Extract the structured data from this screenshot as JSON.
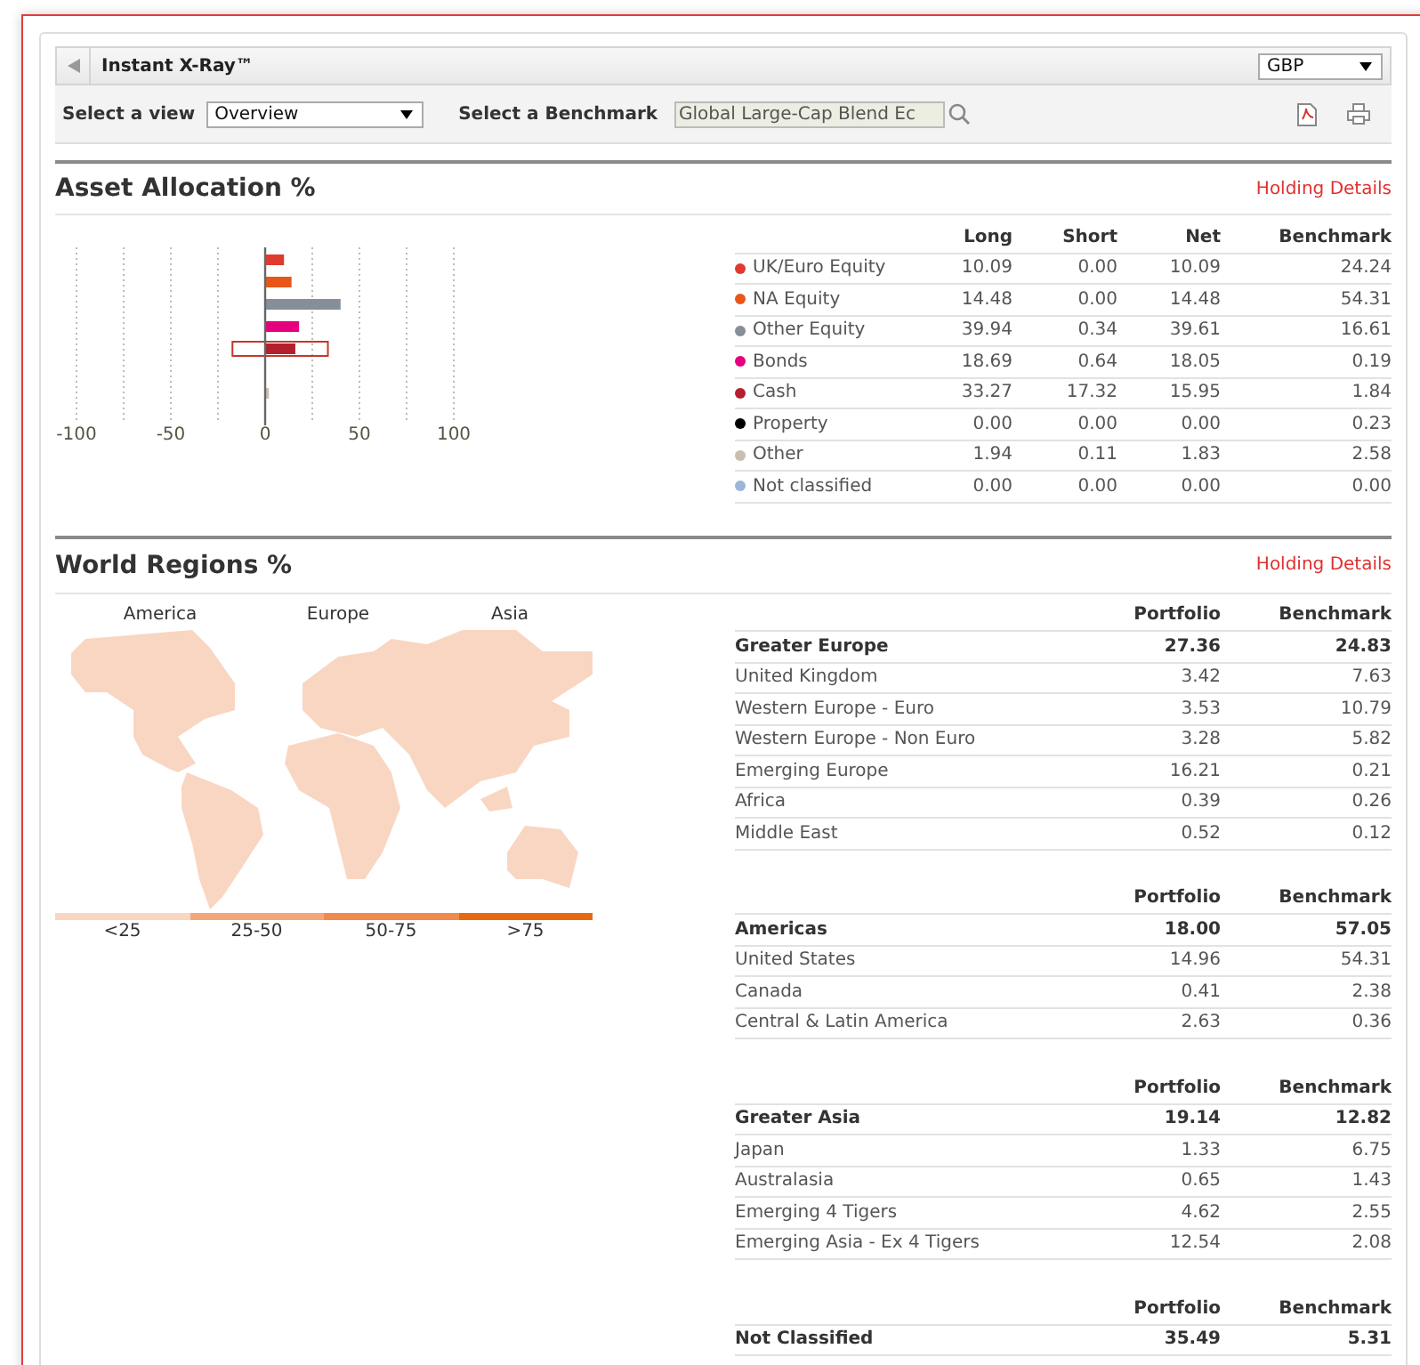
{
  "header": {
    "title": "Instant X-Ray™",
    "currency": "GBP"
  },
  "toolbar": {
    "view_label": "Select a view",
    "view": "Overview",
    "benchmark_label": "Select a Benchmark",
    "benchmark": "Global Large-Cap Blend Ec"
  },
  "asset_allocation": {
    "title": "Asset Allocation %",
    "link": "Holding Details",
    "columns": [
      "Long",
      "Short",
      "Net",
      "Benchmark"
    ],
    "rows": [
      {
        "name": "UK/Euro Equity",
        "color": "#e03a2e",
        "long": "10.09",
        "short": "0.00",
        "net": "10.09",
        "benchmark": "24.24"
      },
      {
        "name": "NA Equity",
        "color": "#e8561a",
        "long": "14.48",
        "short": "0.00",
        "net": "14.48",
        "benchmark": "54.31"
      },
      {
        "name": "Other Equity",
        "color": "#868e98",
        "long": "39.94",
        "short": "0.34",
        "net": "39.61",
        "benchmark": "16.61"
      },
      {
        "name": "Bonds",
        "color": "#e6007e",
        "long": "18.69",
        "short": "0.64",
        "net": "18.05",
        "benchmark": "0.19"
      },
      {
        "name": "Cash",
        "color": "#b41f2e",
        "long": "33.27",
        "short": "17.32",
        "net": "15.95",
        "benchmark": "1.84"
      },
      {
        "name": "Property",
        "color": "#000000",
        "long": "0.00",
        "short": "0.00",
        "net": "0.00",
        "benchmark": "0.23"
      },
      {
        "name": "Other",
        "color": "#c8bfb0",
        "long": "1.94",
        "short": "0.11",
        "net": "1.83",
        "benchmark": "2.58"
      },
      {
        "name": "Not classified",
        "color": "#9ab7d8",
        "long": "0.00",
        "short": "0.00",
        "net": "0.00",
        "benchmark": "0.00"
      }
    ],
    "chart_data": {
      "type": "bar",
      "orientation": "horizontal",
      "xlim": [
        -100,
        100
      ],
      "xticks": [
        -100,
        -50,
        0,
        50,
        100
      ],
      "series": [
        {
          "values": [
            10,
            14,
            40,
            18,
            16,
            0,
            2,
            0
          ]
        }
      ]
    }
  },
  "world_regions": {
    "title": "World Regions %",
    "link": "Holding Details",
    "map_labels": [
      "America",
      "Europe",
      "Asia"
    ],
    "legend": [
      {
        "label": "<25",
        "color": "#fad5c1"
      },
      {
        "label": "25-50",
        "color": "#f4a67a"
      },
      {
        "label": "50-75",
        "color": "#ef8a4c"
      },
      {
        "label": ">75",
        "color": "#e8680f"
      }
    ],
    "groups": [
      {
        "columns": [
          "Portfolio",
          "Benchmark"
        ],
        "total": {
          "name": "Greater Europe",
          "portfolio": "27.36",
          "benchmark": "24.83"
        },
        "rows": [
          {
            "name": "United Kingdom",
            "portfolio": "3.42",
            "benchmark": "7.63"
          },
          {
            "name": "Western Europe - Euro",
            "portfolio": "3.53",
            "benchmark": "10.79"
          },
          {
            "name": "Western Europe - Non Euro",
            "portfolio": "3.28",
            "benchmark": "5.82"
          },
          {
            "name": "Emerging Europe",
            "portfolio": "16.21",
            "benchmark": "0.21"
          },
          {
            "name": "Africa",
            "portfolio": "0.39",
            "benchmark": "0.26"
          },
          {
            "name": "Middle East",
            "portfolio": "0.52",
            "benchmark": "0.12"
          }
        ]
      },
      {
        "columns": [
          "Portfolio",
          "Benchmark"
        ],
        "total": {
          "name": "Americas",
          "portfolio": "18.00",
          "benchmark": "57.05"
        },
        "rows": [
          {
            "name": "United States",
            "portfolio": "14.96",
            "benchmark": "54.31"
          },
          {
            "name": "Canada",
            "portfolio": "0.41",
            "benchmark": "2.38"
          },
          {
            "name": "Central & Latin America",
            "portfolio": "2.63",
            "benchmark": "0.36"
          }
        ]
      },
      {
        "columns": [
          "Portfolio",
          "Benchmark"
        ],
        "total": {
          "name": "Greater Asia",
          "portfolio": "19.14",
          "benchmark": "12.82"
        },
        "rows": [
          {
            "name": "Japan",
            "portfolio": "1.33",
            "benchmark": "6.75"
          },
          {
            "name": "Australasia",
            "portfolio": "0.65",
            "benchmark": "1.43"
          },
          {
            "name": "Emerging 4 Tigers",
            "portfolio": "4.62",
            "benchmark": "2.55"
          },
          {
            "name": "Emerging Asia - Ex 4 Tigers",
            "portfolio": "12.54",
            "benchmark": "2.08"
          }
        ]
      },
      {
        "columns": [
          "Portfolio",
          "Benchmark"
        ],
        "total": {
          "name": "Not Classified",
          "portfolio": "35.49",
          "benchmark": "5.31"
        }
      }
    ]
  }
}
